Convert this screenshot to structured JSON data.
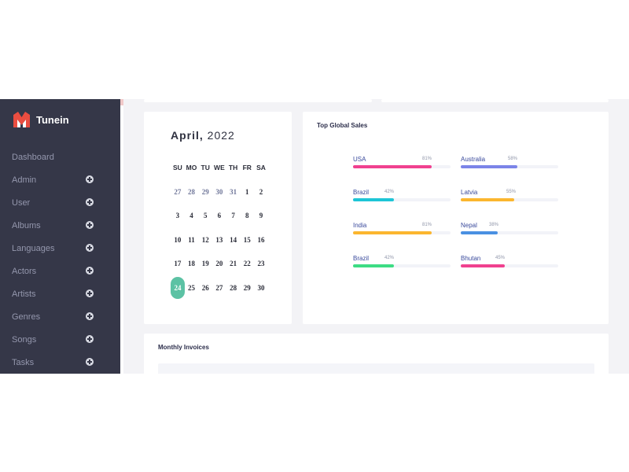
{
  "brand": {
    "name": "Tunein"
  },
  "sidebar": {
    "items": [
      {
        "label": "Dashboard",
        "expandable": false
      },
      {
        "label": "Admin",
        "expandable": true
      },
      {
        "label": "User",
        "expandable": true
      },
      {
        "label": "Albums",
        "expandable": true
      },
      {
        "label": "Languages",
        "expandable": true
      },
      {
        "label": "Actors",
        "expandable": true
      },
      {
        "label": "Artists",
        "expandable": true
      },
      {
        "label": "Genres",
        "expandable": true
      },
      {
        "label": "Songs",
        "expandable": true
      },
      {
        "label": "Tasks",
        "expandable": true
      }
    ]
  },
  "calendar": {
    "month": "April,",
    "year": "2022",
    "weekdays": [
      "SU",
      "MO",
      "TU",
      "WE",
      "TH",
      "FR",
      "SA"
    ],
    "weeks": [
      [
        "27",
        "28",
        "29",
        "30",
        "31",
        "1",
        "2"
      ],
      [
        "3",
        "4",
        "5",
        "6",
        "7",
        "8",
        "9"
      ],
      [
        "10",
        "11",
        "12",
        "13",
        "14",
        "15",
        "16"
      ],
      [
        "17",
        "18",
        "19",
        "20",
        "21",
        "22",
        "23"
      ],
      [
        "24",
        "25",
        "26",
        "27",
        "28",
        "29",
        "30"
      ]
    ],
    "today": "24"
  },
  "sales": {
    "title": "Top Global Sales",
    "items": [
      {
        "country": "USA",
        "percent": "81%",
        "fraction": 0.81,
        "color": "#f0418f"
      },
      {
        "country": "Australia",
        "percent": "58%",
        "fraction": 0.58,
        "color": "#7b84e8"
      },
      {
        "country": "Brazil",
        "percent": "42%",
        "fraction": 0.42,
        "color": "#1ec5d6"
      },
      {
        "country": "Latvia",
        "percent": "55%",
        "fraction": 0.55,
        "color": "#fbb62f"
      },
      {
        "country": "India",
        "percent": "81%",
        "fraction": 0.81,
        "color": "#fbb62f"
      },
      {
        "country": "Nepal",
        "percent": "38%",
        "fraction": 0.38,
        "color": "#4a90e2"
      },
      {
        "country": "Brazil",
        "percent": "42%",
        "fraction": 0.42,
        "color": "#3ddc84"
      },
      {
        "country": "Bhutan",
        "percent": "45%",
        "fraction": 0.45,
        "color": "#f0418f"
      }
    ]
  },
  "invoices": {
    "title": "Monthly Invoices"
  }
}
